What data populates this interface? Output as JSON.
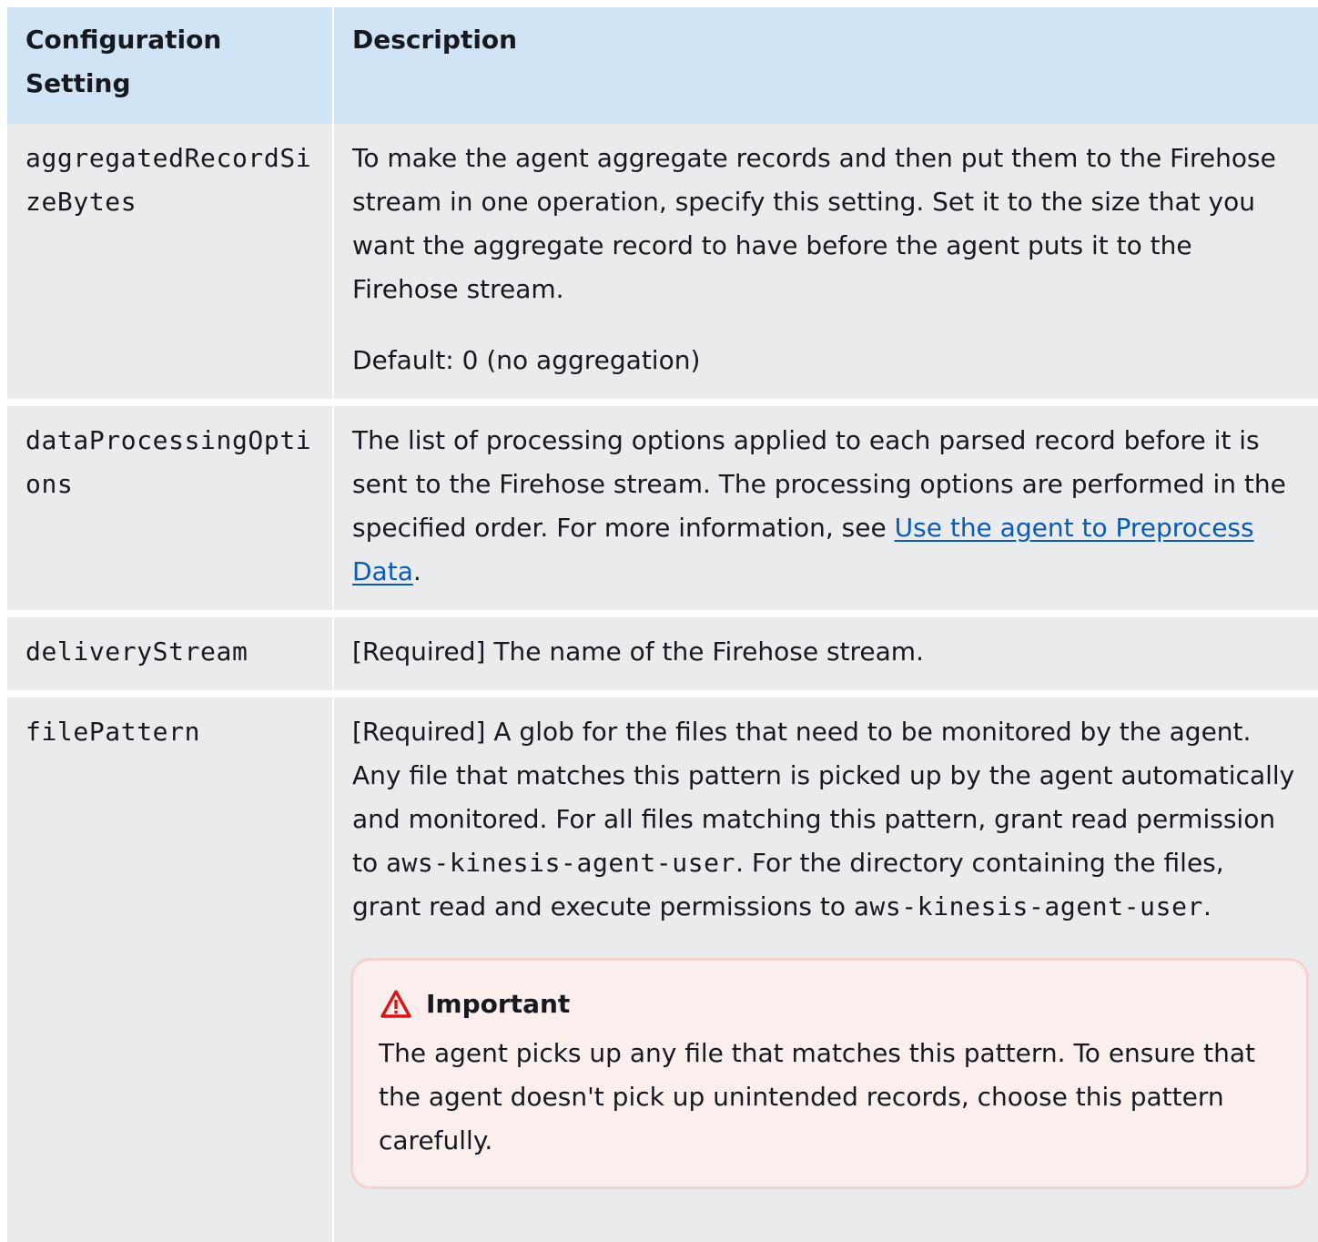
{
  "header": {
    "setting_label": "Configuration Setting",
    "description_label": "Description"
  },
  "rows": [
    {
      "setting": "aggregatedRecordSizeBytes",
      "description": "To make the agent aggregate records and then put them to the Firehose stream in one operation, specify this setting. Set it to the size that you want the aggregate record to have before the agent puts it to the Firehose stream.",
      "default": "Default: 0 (no aggregation)"
    },
    {
      "setting": "dataProcessingOptions",
      "description_prefix": "The list of processing options applied to each parsed record before it is sent to the Firehose stream. The processing options are performed in the specified order. For more information, see ",
      "link_text": "Use the agent to Preprocess Data",
      "description_suffix": "."
    },
    {
      "setting": "deliveryStream",
      "description": "[Required] The name of the Firehose stream."
    },
    {
      "setting": "filePattern",
      "description_part1": "[Required] A glob for the files that need to be monitored by the agent. Any file that matches this pattern is picked up by the agent automatically and monitored. For all files matching this pattern, grant read permission to ",
      "code1": "aws-kinesis-agent-user",
      "description_part2": ". For the directory containing the files, grant read and execute permissions to ",
      "code2": "aws-kinesis-agent-user",
      "description_part3": ".",
      "callout": {
        "icon": "warning-icon",
        "title": "Important",
        "body": "The agent picks up any file that matches this pattern. To ensure that the agent doesn't pick up unintended records, choose this pattern carefully."
      }
    }
  ],
  "colors": {
    "header_bg": "#d1e4f5",
    "row_bg": "#e9ebed",
    "link": "#0a5bb5",
    "callout_bg": "#fbefee",
    "callout_border": "#f6d1cd",
    "warning": "#d91515"
  }
}
